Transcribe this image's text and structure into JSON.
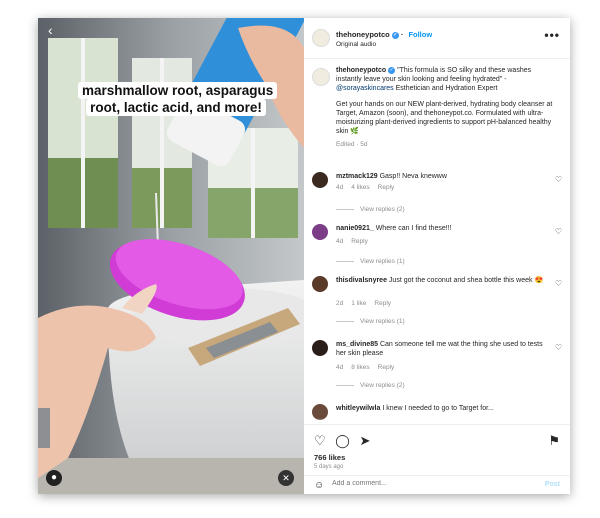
{
  "media": {
    "caption": "marshmallow root, asparagus root, lactic acid, and more!",
    "icons": [
      "back-icon",
      "account-icon",
      "mute-icon"
    ]
  },
  "header": {
    "username": "thehoneypotco",
    "follow_label": "Follow",
    "subtitle": "Original audio",
    "more_label": "•••"
  },
  "post": {
    "username": "thehoneypotco",
    "quote": "\"This formula is SO silky and these washes instantly leave your skin looking and feeling hydrated\" -",
    "mention": "@sorayaskincares",
    "mention_suffix": "Esthetician and Hydration Expert",
    "paragraph": "Get your hands on our NEW plant-derived, hydrating body cleanser at Target, Amazon (soon), and thehoneypot.co. Formulated with ultra-moisturizing plant-derived ingredients to support pH-balanced healthy skin 🌿",
    "meta": "Edited · 5d"
  },
  "comments": [
    {
      "user": "mztmack129",
      "text": "Gasp!! Neva knewww",
      "age": "4d",
      "likes": "4 likes",
      "reply": "Reply",
      "replies": "View replies (2)",
      "avatar_color": "#3b2a20"
    },
    {
      "user": "nanie0921_",
      "text": "Where can I find these!!!",
      "age": "4d",
      "likes": "",
      "reply": "Reply",
      "replies": "View replies (1)",
      "avatar_color": "#7a3d86"
    },
    {
      "user": "thisdivalsnyree",
      "text": "Just got the coconut and shea bottle this week 😍",
      "age": "2d",
      "likes": "1 like",
      "reply": "Reply",
      "replies": "View replies (1)",
      "avatar_color": "#5a3a28"
    },
    {
      "user": "ms_divine85",
      "text": "Can someone tell me wat the thing she used to tests her skin please",
      "age": "4d",
      "likes": "8 likes",
      "reply": "Reply",
      "replies": "View replies (2)",
      "avatar_color": "#2a1e18"
    },
    {
      "user": "whitleywilwla",
      "text": "I knew I needed to go to Target for...",
      "age": "",
      "likes": "",
      "reply": "",
      "replies": "",
      "avatar_color": "#6a4a3a"
    }
  ],
  "actions": {
    "likes": "766 likes",
    "ago": "5 days ago",
    "comment_placeholder": "Add a comment...",
    "post_label": "Post"
  }
}
